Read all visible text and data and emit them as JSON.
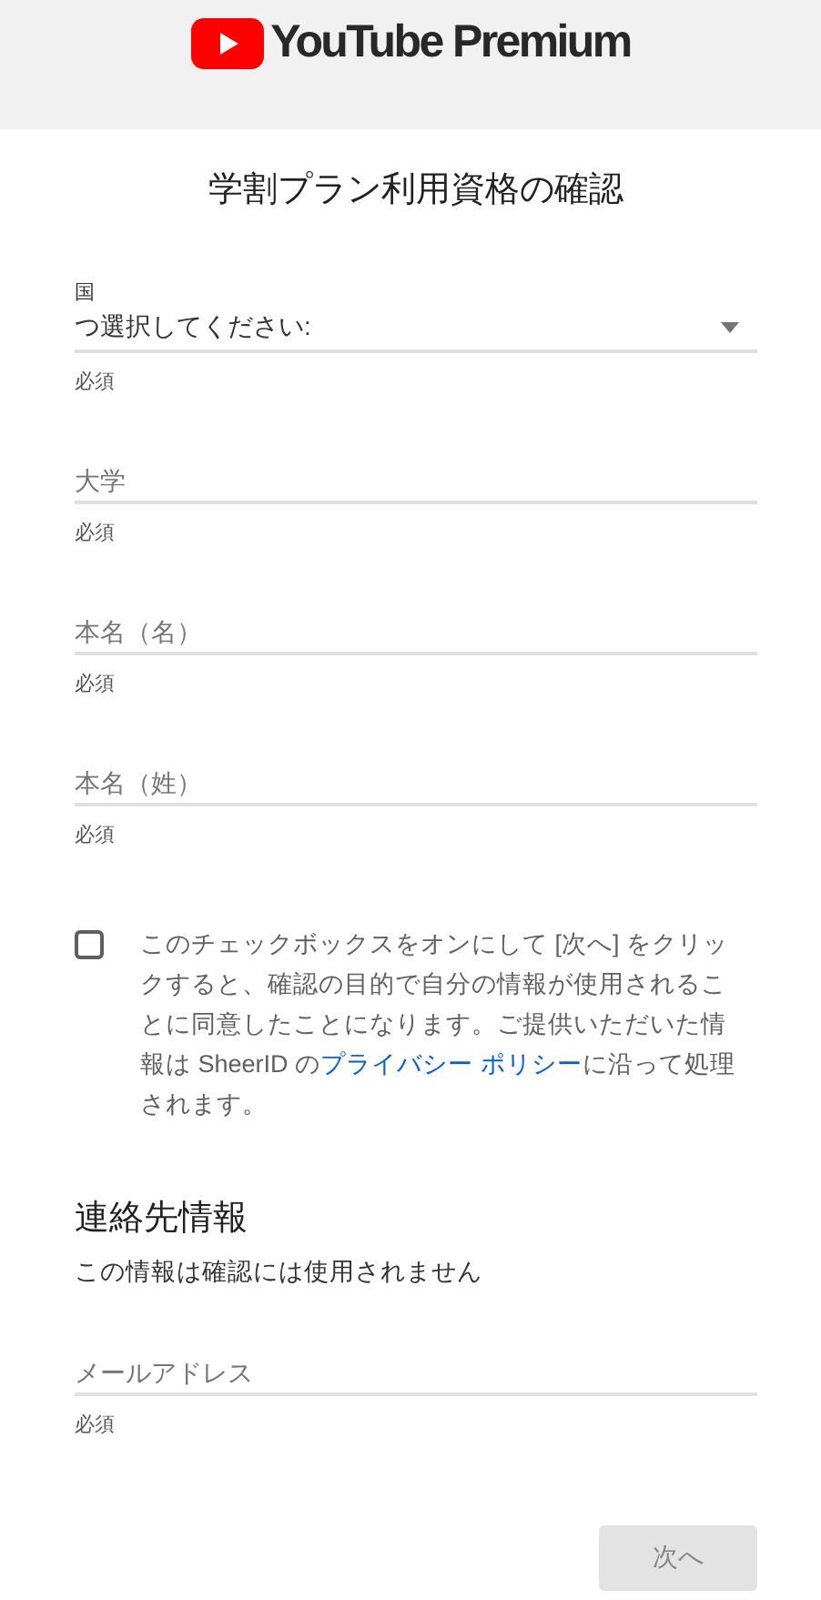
{
  "header": {
    "logo_text": "YouTube Premium"
  },
  "title": "学割プラン利用資格の確認",
  "fields": [
    {
      "kind": "select",
      "label": "国",
      "value": "つ選択してください:",
      "helper": "必須"
    },
    {
      "kind": "text",
      "placeholder": "大学",
      "helper": "必須"
    },
    {
      "kind": "text",
      "placeholder": "本名（名）",
      "helper": "必須"
    },
    {
      "kind": "text",
      "placeholder": "本名（姓）",
      "helper": "必須"
    }
  ],
  "consent": {
    "checked": false,
    "text_before": "このチェックボックスをオンにして [次へ] をクリックすると、確認の目的で自分の情報が使用されることに同意したことになります。ご提供いただいた情報は SheerID の",
    "link": "プライバシー ポリシー",
    "text_after": "に沿って処理されます。"
  },
  "contact": {
    "heading": "連絡先情報",
    "subtitle": "この情報は確認には使用されません",
    "fields": [
      {
        "kind": "text",
        "placeholder": "メールアドレス",
        "helper": "必須"
      }
    ]
  },
  "next_button": {
    "label": "次へ",
    "disabled": true
  }
}
